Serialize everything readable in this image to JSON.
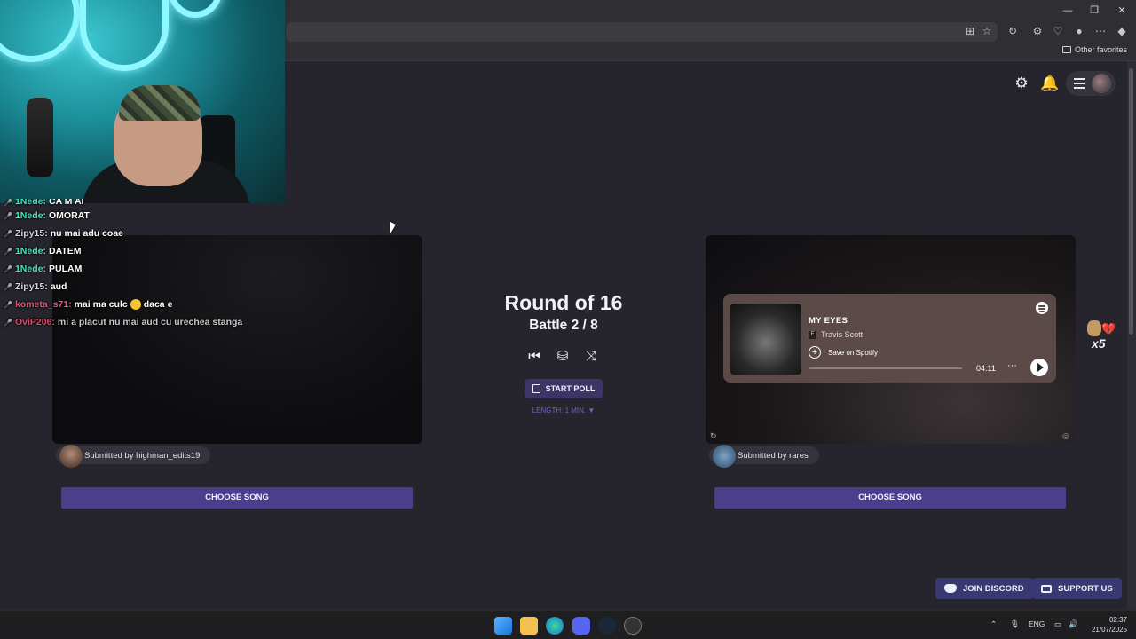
{
  "browser": {
    "favorites_label": "Other favorites",
    "window_controls": {
      "minimize": "—",
      "maximize": "❐",
      "close": "✕"
    }
  },
  "chat": {
    "messages": [
      {
        "user": "1Nede:",
        "text": "CA M AI",
        "badge": "🎤"
      },
      {
        "user": "1Nede:",
        "text": "OMORAT",
        "badge": "🎤"
      },
      {
        "user": "Zipy15:",
        "text": "nu mai adu coae",
        "badge": "🎤"
      },
      {
        "user": "1Nede:",
        "text": "DATEM",
        "badge": "🎤"
      },
      {
        "user": "1Nede:",
        "text": "PULAM",
        "badge": "🎤"
      },
      {
        "user": "Zipy15:",
        "text": "aud",
        "badge": "🎤"
      },
      {
        "user": "kometa_s71:",
        "text": "mai ma culc",
        "text2": "daca e",
        "badge": "🎤"
      },
      {
        "user": "OviP206:",
        "text": "mi a placut nu mai aud cu urechea stanga",
        "badge": "🎤"
      }
    ]
  },
  "battle": {
    "round_title": "Round of 16",
    "battle_label": "Battle 2 / 8",
    "start_poll_label": "START POLL",
    "length_label": "LENGTH: 1 MIN. ▼"
  },
  "left_card": {
    "submitted_by": "Submitted by highman_edits19",
    "choose_label": "CHOOSE SONG"
  },
  "right_card": {
    "submitted_by": "Submitted by rares",
    "choose_label": "CHOOSE SONG",
    "spotify": {
      "title": "MY EYES",
      "explicit_badge": "E",
      "artist": "Travis Scott",
      "save_label": "Save on Spotify",
      "duration": "04:11",
      "more": "···"
    }
  },
  "side_widget": {
    "count": "x5"
  },
  "footer": {
    "join_discord": "JOIN DISCORD",
    "support_us": "SUPPORT US"
  },
  "taskbar": {
    "language": "ENG",
    "time": "02:37",
    "date": "21/07/2025"
  },
  "colors": {
    "accent_purple": "#4a3f8a",
    "page_bg": "#26252d",
    "username_teal": "#3ee8c5"
  }
}
